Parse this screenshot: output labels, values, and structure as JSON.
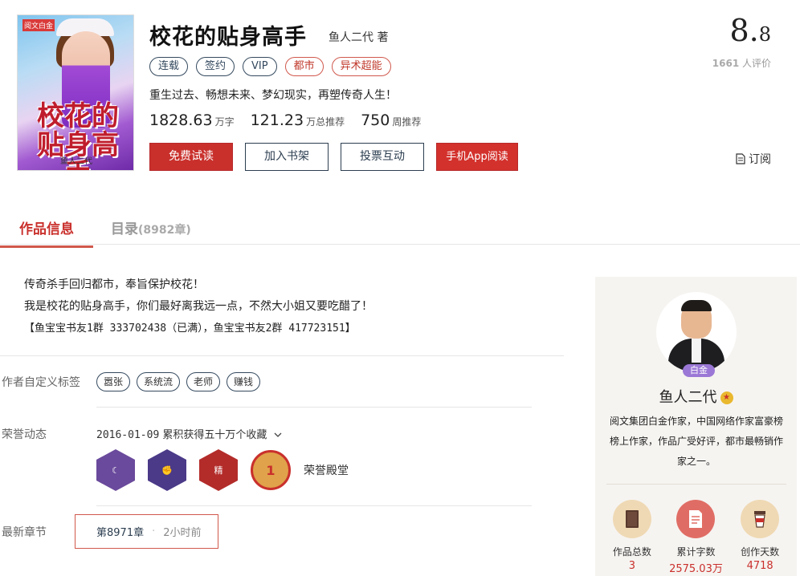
{
  "book": {
    "cover_publisher": "阅文白金",
    "cover_title": "校花的贴身高手",
    "cover_author": "鱼人二代",
    "title": "校花的贴身高手",
    "author": "鱼人二代 著",
    "tags": [
      {
        "label": "连载",
        "style": "blue"
      },
      {
        "label": "签约",
        "style": "blue"
      },
      {
        "label": "VIP",
        "style": "blue"
      },
      {
        "label": "都市",
        "style": "red"
      },
      {
        "label": "异术超能",
        "style": "red"
      }
    ],
    "slogan": "重生过去、畅想未来、梦幻现实，再塑传奇人生！",
    "stats": [
      {
        "num": "1828.63",
        "unit": "万字"
      },
      {
        "num": "121.23",
        "unit": "万总推荐"
      },
      {
        "num": "750",
        "unit": "周推荐"
      }
    ],
    "buttons": {
      "free_read": "免费试读",
      "add_shelf": "加入书架",
      "vote": "投票互动",
      "app_read": "手机App阅读"
    },
    "score_int": "8.",
    "score_dec": "8",
    "rating_count": "1661",
    "rating_suffix": " 人评价",
    "subscribe": "订阅"
  },
  "tabs": {
    "info": "作品信息",
    "catalog": "目录",
    "catalog_count": "(8982章)"
  },
  "intro": {
    "lines": [
      "传奇杀手回归都市，奉旨保护校花！",
      "我是校花的贴身高手，你们最好离我远一点，不然大小姐又要吃醋了！",
      "【鱼宝宝书友1群 333702438（已满），鱼宝宝书友2群 417723151】"
    ]
  },
  "author_tags": {
    "label": "作者自定义标签",
    "tags": [
      "嚣张",
      "系统流",
      "老师",
      "赚钱"
    ]
  },
  "honors": {
    "label": "荣誉动态",
    "date": "2016-01-09",
    "text": "累积获得五十万个收藏",
    "badges": [
      {
        "name": "moon-badge",
        "glyph": "☾"
      },
      {
        "name": "fist-badge",
        "glyph": "✊"
      },
      {
        "name": "quality-badge",
        "glyph": "精"
      },
      {
        "name": "rank-first-badge",
        "glyph": "1"
      }
    ],
    "hall": "荣誉殿堂"
  },
  "latest": {
    "label": "最新章节",
    "chapter": "第8971章",
    "sep": "·",
    "time": "2小时前"
  },
  "author_panel": {
    "level": "白金",
    "name": "鱼人二代",
    "desc": "阅文集团白金作家，中国网络作家富豪榜榜上作家，作品广受好评，都市最畅销作家之一。",
    "stats": [
      {
        "label": "作品总数",
        "value": "3",
        "icon": "book-icon"
      },
      {
        "label": "累计字数",
        "value": "2575.03万",
        "icon": "document-icon"
      },
      {
        "label": "创作天数",
        "value": "4718",
        "icon": "cup-icon"
      }
    ]
  },
  "colors": {
    "accent_red": "#c9302c",
    "navy": "#2c3e50",
    "panel_bg": "#f6f4f1"
  }
}
